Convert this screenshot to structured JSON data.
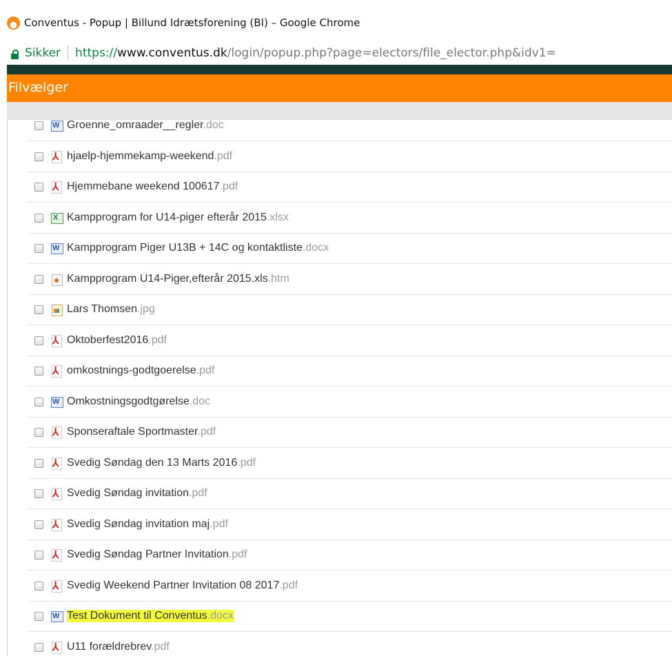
{
  "window": {
    "title": "Conventus - Popup | Billund Idrætsforening (BI) – Google Chrome",
    "favicon": "conventus-logo-icon"
  },
  "address_bar": {
    "security_label": "Sikker",
    "url_scheme": "https://",
    "url_host": "www.conventus.dk",
    "url_path": "/login/popup.php?page=electors/file_elector.php&idv1="
  },
  "header": {
    "title": "Filvælger",
    "accent_color": "#fd8400",
    "dark_color": "#173a33"
  },
  "files": [
    {
      "name": "Groenne_omraader__regler",
      "ext": ".doc",
      "icon": "word-doc-icon",
      "highlighted": false
    },
    {
      "name": "hjaelp-hjemmekamp-weekend",
      "ext": ".pdf",
      "icon": "pdf-icon",
      "highlighted": false
    },
    {
      "name": "Hjemmebane weekend 100617",
      "ext": ".pdf",
      "icon": "pdf-icon",
      "highlighted": false
    },
    {
      "name": "Kampprogram for U14-piger efterår 2015",
      "ext": ".xlsx",
      "icon": "excel-icon",
      "highlighted": false
    },
    {
      "name": "Kampprogram Piger U13B + 14C og kontaktliste",
      "ext": ".docx",
      "icon": "word-doc-icon",
      "highlighted": false
    },
    {
      "name": "Kampprogram U14-Piger,efterår 2015.xls",
      "ext": ".htm",
      "icon": "html-file-icon",
      "highlighted": false
    },
    {
      "name": "Lars Thomsen",
      "ext": ".jpg",
      "icon": "image-file-icon",
      "highlighted": false
    },
    {
      "name": "Oktoberfest2016",
      "ext": ".pdf",
      "icon": "pdf-icon",
      "highlighted": false
    },
    {
      "name": "omkostnings-godtgoerelse",
      "ext": ".pdf",
      "icon": "pdf-icon",
      "highlighted": false
    },
    {
      "name": "Omkostningsgodtgørelse",
      "ext": ".doc",
      "icon": "word-doc-icon",
      "highlighted": false
    },
    {
      "name": "Sponseraftale Sportmaster",
      "ext": ".pdf",
      "icon": "pdf-icon",
      "highlighted": false
    },
    {
      "name": "Svedig Søndag den 13 Marts 2016",
      "ext": ".pdf",
      "icon": "pdf-icon",
      "highlighted": false
    },
    {
      "name": "Svedig Søndag invitation",
      "ext": ".pdf",
      "icon": "pdf-icon",
      "highlighted": false
    },
    {
      "name": "Svedig Søndag invitation maj",
      "ext": ".pdf",
      "icon": "pdf-icon",
      "highlighted": false
    },
    {
      "name": "Svedig Søndag Partner Invitation",
      "ext": ".pdf",
      "icon": "pdf-icon",
      "highlighted": false
    },
    {
      "name": "Svedig Weekend Partner Invitation 08 2017",
      "ext": ".pdf",
      "icon": "pdf-icon",
      "highlighted": false
    },
    {
      "name": "Test Dokument til Conventus",
      "ext": ".docx",
      "icon": "word-doc-icon",
      "highlighted": true
    },
    {
      "name": "U11 forældrebrev",
      "ext": ".pdf",
      "icon": "pdf-icon",
      "highlighted": false
    }
  ],
  "highlight_color": "#f4fb3a"
}
